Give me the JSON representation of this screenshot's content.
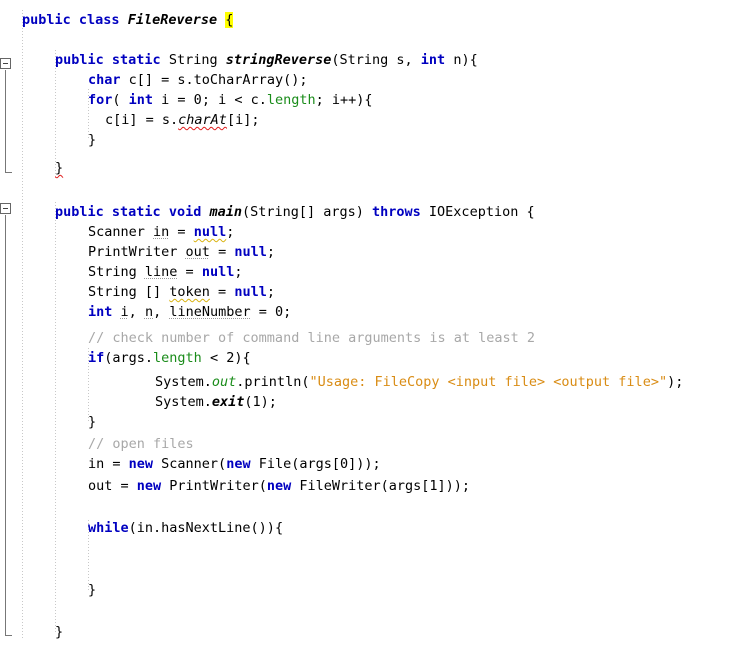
{
  "editor": {
    "language": "java",
    "class_name": "FileReverse",
    "background_color": "#ffffff",
    "keyword_color": "#0000c0",
    "string_color": "#d98c14",
    "comment_color": "#a8a8a8",
    "field_color": "#1a8c1a",
    "brace_highlight_color": "#ffff00",
    "error_squiggle_color": "#e01b1b",
    "warning_squiggle_color": "#d9b310"
  },
  "gutter": {
    "fold_markers": [
      {
        "label": "−",
        "state": "expanded",
        "region": "stringReverse-method"
      },
      {
        "label": "−",
        "state": "expanded",
        "region": "main-method"
      }
    ]
  },
  "code": {
    "lines": [
      {
        "n": 1,
        "indent": 0,
        "text": "public class FileReverse {"
      },
      {
        "n": 2,
        "indent": 0,
        "text": ""
      },
      {
        "n": 3,
        "indent": 1,
        "text": "public static String stringReverse(String s, int n){"
      },
      {
        "n": 4,
        "indent": 2,
        "text": "char c[] = s.toCharArray();"
      },
      {
        "n": 5,
        "indent": 2,
        "text": "for( int i = 0; i < c.length; i++){"
      },
      {
        "n": 6,
        "indent": 3,
        "text": "c[i] = s.charAt[i];"
      },
      {
        "n": 7,
        "indent": 2,
        "text": "}"
      },
      {
        "n": 8,
        "indent": 0,
        "text": ""
      },
      {
        "n": 9,
        "indent": 1,
        "text": "}"
      },
      {
        "n": 10,
        "indent": 0,
        "text": ""
      },
      {
        "n": 11,
        "indent": 1,
        "text": "public static void main(String[] args) throws IOException {"
      },
      {
        "n": 12,
        "indent": 2,
        "text": "Scanner in = null;"
      },
      {
        "n": 13,
        "indent": 2,
        "text": "PrintWriter out = null;"
      },
      {
        "n": 14,
        "indent": 2,
        "text": "String line = null;"
      },
      {
        "n": 15,
        "indent": 2,
        "text": "String [] token = null;"
      },
      {
        "n": 16,
        "indent": 2,
        "text": "int i, n, lineNumber = 0;"
      },
      {
        "n": 17,
        "indent": 2,
        "text": "// check number of command line arguments is at least 2"
      },
      {
        "n": 18,
        "indent": 2,
        "text": "if(args.length < 2){"
      },
      {
        "n": 19,
        "indent": 4,
        "text": "System.out.println(\"Usage: FileCopy <input file> <output file>\");"
      },
      {
        "n": 20,
        "indent": 4,
        "text": "System.exit(1);"
      },
      {
        "n": 21,
        "indent": 2,
        "text": "}"
      },
      {
        "n": 22,
        "indent": 2,
        "text": "// open files"
      },
      {
        "n": 23,
        "indent": 2,
        "text": "in = new Scanner(new File(args[0]));"
      },
      {
        "n": 24,
        "indent": 2,
        "text": "out = new PrintWriter(new FileWriter(args[1]));"
      },
      {
        "n": 25,
        "indent": 0,
        "text": ""
      },
      {
        "n": 26,
        "indent": 2,
        "text": "while(in.hasNextLine()){"
      },
      {
        "n": 27,
        "indent": 0,
        "text": ""
      },
      {
        "n": 28,
        "indent": 0,
        "text": ""
      },
      {
        "n": 29,
        "indent": 2,
        "text": "}"
      },
      {
        "n": 30,
        "indent": 0,
        "text": ""
      },
      {
        "n": 31,
        "indent": 1,
        "text": "}"
      }
    ],
    "diagnostics": [
      {
        "line": 6,
        "token": "charAt",
        "severity": "error"
      },
      {
        "line": 9,
        "token": "}",
        "severity": "error"
      },
      {
        "line": 12,
        "token": "in",
        "severity": "hint"
      },
      {
        "line": 12,
        "token": "null",
        "severity": "warning"
      },
      {
        "line": 13,
        "token": "out",
        "severity": "hint"
      },
      {
        "line": 14,
        "token": "line",
        "severity": "hint"
      },
      {
        "line": 15,
        "token": "token",
        "severity": "warning"
      },
      {
        "line": 16,
        "token": "i",
        "severity": "hint"
      },
      {
        "line": 16,
        "token": "n",
        "severity": "hint"
      },
      {
        "line": 16,
        "token": "lineNumber",
        "severity": "hint"
      }
    ],
    "brace_match": {
      "line": 1,
      "token": "{",
      "highlight": "#ffff00"
    }
  },
  "tokens": {
    "l1": [
      {
        "t": "public ",
        "c": "kw"
      },
      {
        "t": "class ",
        "c": "kw"
      },
      {
        "t": "FileReverse",
        "c": "stat"
      },
      {
        "t": " ",
        "c": "plain"
      },
      {
        "t": "{",
        "c": "hl"
      }
    ],
    "l3": [
      {
        "t": "public ",
        "c": "kw"
      },
      {
        "t": "static ",
        "c": "kw"
      },
      {
        "t": "String ",
        "c": "plain"
      },
      {
        "t": "stringReverse",
        "c": "mname"
      },
      {
        "t": "(String s, ",
        "c": "plain"
      },
      {
        "t": "int",
        "c": "kw"
      },
      {
        "t": " n){",
        "c": "plain"
      }
    ],
    "l4": [
      {
        "t": "char",
        "c": "kw"
      },
      {
        "t": " c[] = s.toCharArray();",
        "c": "plain"
      }
    ],
    "l5": [
      {
        "t": "for",
        "c": "kw"
      },
      {
        "t": "( ",
        "c": "plain"
      },
      {
        "t": "int",
        "c": "kw"
      },
      {
        "t": " i = 0; i < c.",
        "c": "plain"
      },
      {
        "t": "length",
        "c": "field"
      },
      {
        "t": "; i++){",
        "c": "plain"
      }
    ],
    "l6": [
      {
        "t": "c[i] = s.",
        "c": "plain"
      },
      {
        "t": "charAt",
        "c": "err-ital"
      },
      {
        "t": "[i];",
        "c": "plain"
      }
    ],
    "l7": [
      {
        "t": "}",
        "c": "plain"
      }
    ],
    "l9": [
      {
        "t": "}",
        "c": "err"
      }
    ],
    "l11": [
      {
        "t": "public ",
        "c": "kw"
      },
      {
        "t": "static ",
        "c": "kw"
      },
      {
        "t": "void ",
        "c": "kw"
      },
      {
        "t": "main",
        "c": "mname"
      },
      {
        "t": "(String[] args) ",
        "c": "plain"
      },
      {
        "t": "throws",
        "c": "kw"
      },
      {
        "t": " IOException {",
        "c": "plain"
      }
    ],
    "l12": [
      {
        "t": "Scanner ",
        "c": "plain"
      },
      {
        "t": "in",
        "c": "hint"
      },
      {
        "t": " = ",
        "c": "plain"
      },
      {
        "t": "null",
        "c": "kw-warn"
      },
      {
        "t": ";",
        "c": "plain"
      }
    ],
    "l13": [
      {
        "t": "PrintWriter ",
        "c": "plain"
      },
      {
        "t": "out",
        "c": "hint"
      },
      {
        "t": " = ",
        "c": "plain"
      },
      {
        "t": "null",
        "c": "kw"
      },
      {
        "t": ";",
        "c": "plain"
      }
    ],
    "l14": [
      {
        "t": "String ",
        "c": "plain"
      },
      {
        "t": "line",
        "c": "hint"
      },
      {
        "t": " = ",
        "c": "plain"
      },
      {
        "t": "null",
        "c": "kw"
      },
      {
        "t": ";",
        "c": "plain"
      }
    ],
    "l15": [
      {
        "t": "String [] ",
        "c": "plain"
      },
      {
        "t": "token",
        "c": "warn"
      },
      {
        "t": " = ",
        "c": "plain"
      },
      {
        "t": "null",
        "c": "kw"
      },
      {
        "t": ";",
        "c": "plain"
      }
    ],
    "l16": [
      {
        "t": "int",
        "c": "kw"
      },
      {
        "t": " ",
        "c": "plain"
      },
      {
        "t": "i",
        "c": "hint"
      },
      {
        "t": ", ",
        "c": "plain"
      },
      {
        "t": "n",
        "c": "hint"
      },
      {
        "t": ", ",
        "c": "plain"
      },
      {
        "t": "lineNumber",
        "c": "hint"
      },
      {
        "t": " = 0;",
        "c": "plain"
      }
    ],
    "l17": [
      {
        "t": "// check number of command line arguments is at least 2",
        "c": "cmt"
      }
    ],
    "l18": [
      {
        "t": "if",
        "c": "kw"
      },
      {
        "t": "(args.",
        "c": "plain"
      },
      {
        "t": "length",
        "c": "field"
      },
      {
        "t": " < 2){",
        "c": "plain"
      }
    ],
    "l19": [
      {
        "t": "System.",
        "c": "plain"
      },
      {
        "t": "out",
        "c": "statg"
      },
      {
        "t": ".println(",
        "c": "plain"
      },
      {
        "t": "\"Usage: FileCopy <input file> <output file>\"",
        "c": "str"
      },
      {
        "t": ");",
        "c": "plain"
      }
    ],
    "l20": [
      {
        "t": "System.",
        "c": "plain"
      },
      {
        "t": "exit",
        "c": "stat-ital"
      },
      {
        "t": "(1);",
        "c": "plain"
      }
    ],
    "l21": [
      {
        "t": "}",
        "c": "plain"
      }
    ],
    "l22": [
      {
        "t": "// open files",
        "c": "cmt"
      }
    ],
    "l23": [
      {
        "t": "in = ",
        "c": "plain"
      },
      {
        "t": "new",
        "c": "kw"
      },
      {
        "t": " Scanner(",
        "c": "plain"
      },
      {
        "t": "new",
        "c": "kw"
      },
      {
        "t": " File(args[0]));",
        "c": "plain"
      }
    ],
    "l24": [
      {
        "t": "out = ",
        "c": "plain"
      },
      {
        "t": "new",
        "c": "kw"
      },
      {
        "t": " PrintWriter(",
        "c": "plain"
      },
      {
        "t": "new",
        "c": "kw"
      },
      {
        "t": " FileWriter(args[1]));",
        "c": "plain"
      }
    ],
    "l26": [
      {
        "t": "while",
        "c": "kw"
      },
      {
        "t": "(in.hasNextLine()){",
        "c": "plain"
      }
    ],
    "l29": [
      {
        "t": "}",
        "c": "plain"
      }
    ],
    "l31": [
      {
        "t": "}",
        "c": "plain"
      }
    ]
  }
}
